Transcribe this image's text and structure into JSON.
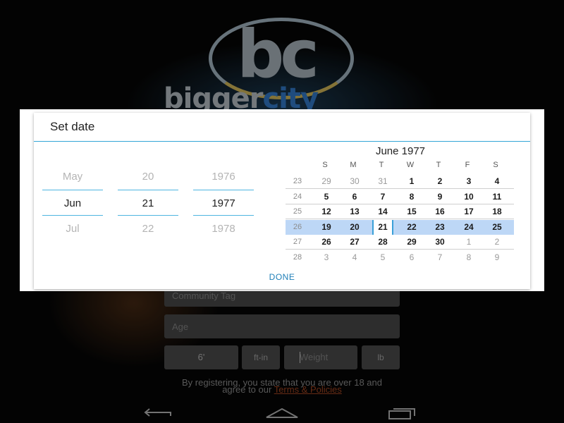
{
  "logo": {
    "glyph": "bc",
    "brand_part1": "bigger",
    "brand_part2": "city"
  },
  "form": {
    "community_tag_placeholder": "Community Tag",
    "age_placeholder": "Age",
    "height_value": "6'",
    "height_unit": "ft-in",
    "weight_placeholder": "Weight",
    "weight_unit": "lb",
    "legal_text": "By registering, you state that you are over 18 and agree to our",
    "terms_link": "Terms & Policies"
  },
  "dialog": {
    "title": "Set date",
    "done_label": "DONE",
    "spinners": {
      "month": {
        "prev": "May",
        "current": "Jun",
        "next": "Jul"
      },
      "day": {
        "prev": "20",
        "current": "21",
        "next": "22"
      },
      "year": {
        "prev": "1976",
        "current": "1977",
        "next": "1978"
      }
    },
    "calendar": {
      "month_title": "June 1977",
      "weekdays": [
        "S",
        "M",
        "T",
        "W",
        "T",
        "F",
        "S"
      ],
      "weeks": [
        {
          "num": "23",
          "days": [
            "29",
            "30",
            "31",
            "1",
            "2",
            "3",
            "4"
          ],
          "other": [
            0,
            1,
            2
          ]
        },
        {
          "num": "24",
          "days": [
            "5",
            "6",
            "7",
            "8",
            "9",
            "10",
            "11"
          ],
          "other": []
        },
        {
          "num": "25",
          "days": [
            "12",
            "13",
            "14",
            "15",
            "16",
            "17",
            "18"
          ],
          "other": []
        },
        {
          "num": "26",
          "days": [
            "19",
            "20",
            "21",
            "22",
            "23",
            "24",
            "25"
          ],
          "other": [],
          "selected": true
        },
        {
          "num": "27",
          "days": [
            "26",
            "27",
            "28",
            "29",
            "30",
            "1",
            "2"
          ],
          "other": [
            5,
            6
          ]
        },
        {
          "num": "28",
          "days": [
            "3",
            "4",
            "5",
            "6",
            "7",
            "8",
            "9"
          ],
          "other": [
            0,
            1,
            2,
            3,
            4,
            5,
            6
          ]
        }
      ],
      "selected_day": "21"
    }
  },
  "colors": {
    "accent": "#33a6d6",
    "selected_week": "#bdd7f6",
    "done": "#1f7fb8",
    "brand_blue": "#2a66a8"
  },
  "navbar": {
    "icons": [
      "back-icon",
      "home-icon",
      "recent-apps-icon"
    ]
  }
}
